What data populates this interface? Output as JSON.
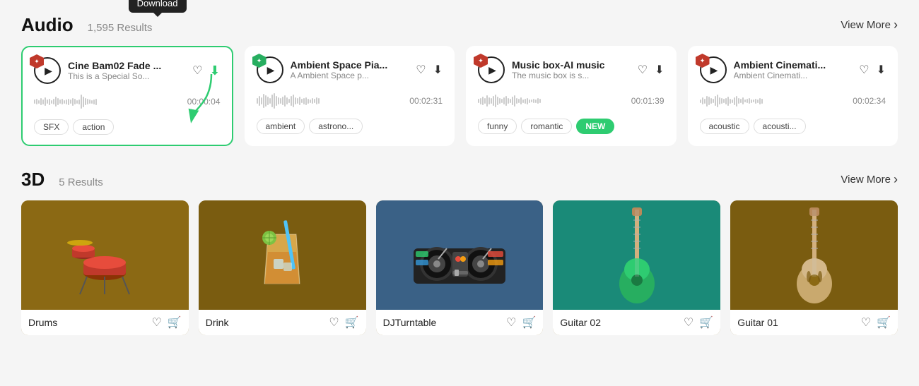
{
  "audio_section": {
    "title": "Audio",
    "count": "1,595 Results",
    "view_more": "View More",
    "cards": [
      {
        "id": "card1",
        "active": true,
        "title": "Cine Bam02 Fade ...",
        "subtitle": "This is a Special So...",
        "duration": "00:00:04",
        "tags": [
          "SFX",
          "action"
        ],
        "shield_color": "red"
      },
      {
        "id": "card2",
        "active": false,
        "title": "Ambient Space Pia...",
        "subtitle": "A Ambient Space p...",
        "duration": "00:02:31",
        "tags": [
          "ambient",
          "astrono..."
        ],
        "shield_color": "green"
      },
      {
        "id": "card3",
        "active": false,
        "title": "Music box-AI music",
        "subtitle": "The music box is s...",
        "duration": "00:01:39",
        "tags": [
          "funny",
          "romantic"
        ],
        "new_badge": "NEW",
        "shield_color": "red"
      },
      {
        "id": "card4",
        "active": false,
        "title": "Ambient Cinemati...",
        "subtitle": "Ambient Cinemati...",
        "duration": "00:02:34",
        "tags": [
          "acoustic",
          "acousti..."
        ],
        "shield_color": "red"
      }
    ],
    "download_tooltip": "Download"
  },
  "section_3d": {
    "title": "3D",
    "count": "5 Results",
    "view_more": "View More",
    "items": [
      {
        "id": "item1",
        "name": "Drums",
        "bg": "drums-bg"
      },
      {
        "id": "item2",
        "name": "Drink",
        "bg": "drink-bg"
      },
      {
        "id": "item3",
        "name": "DJTurntable",
        "bg": "dj-bg"
      },
      {
        "id": "item4",
        "name": "Guitar 02",
        "bg": "guitar2-bg"
      },
      {
        "id": "item5",
        "name": "Guitar 01",
        "bg": "guitar1-bg"
      }
    ]
  }
}
